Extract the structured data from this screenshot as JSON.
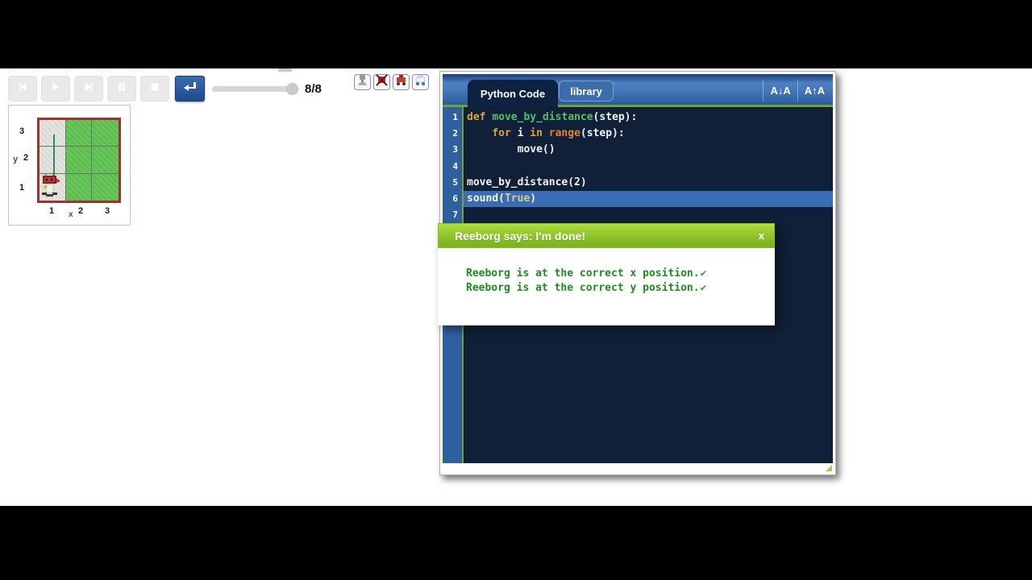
{
  "player": {
    "buttons": [
      {
        "name": "skip-to-start",
        "icon": "skip-to-start"
      },
      {
        "name": "play",
        "icon": "play"
      },
      {
        "name": "skip-to-end",
        "icon": "skip-to-end"
      },
      {
        "name": "pause",
        "icon": "pause"
      },
      {
        "name": "stop",
        "icon": "stop"
      }
    ],
    "run_button_icon": "return-arrow",
    "step_counter": "8/8",
    "slider_position": "end"
  },
  "robot_toolbar": {
    "buttons": [
      {
        "name": "robot-classic",
        "icon": "robot-classic"
      },
      {
        "name": "robot-delete",
        "icon": "robot-delete"
      },
      {
        "name": "robot-rover-red",
        "icon": "robot-rover-red"
      },
      {
        "name": "robot-rover-white",
        "icon": "robot-rover-white"
      }
    ]
  },
  "world": {
    "y_axis_label": "y",
    "x_axis_label": "x",
    "y_ticks": [
      "3",
      "2",
      "1"
    ],
    "x_ticks": [
      "1",
      "2",
      "3"
    ],
    "cells": [
      [
        "path",
        "grass",
        "grass"
      ],
      [
        "path",
        "grass",
        "grass"
      ],
      [
        "path",
        "grass",
        "grass"
      ]
    ],
    "robot_position": "column 1, row 1",
    "trace_color": "#2e8878"
  },
  "editor": {
    "tabs": [
      {
        "label": "Python Code",
        "active": true
      },
      {
        "label": "library",
        "active": false
      }
    ],
    "font_decrease_label": "A↓A",
    "font_increase_label": "A↑A",
    "lines": [
      {
        "num": "1",
        "tokens": [
          {
            "t": "def ",
            "c": "kw"
          },
          {
            "t": "move_by_distance",
            "c": "fn"
          },
          {
            "t": "(step):",
            "c": "pl"
          }
        ]
      },
      {
        "num": "2",
        "tokens": [
          {
            "t": "    ",
            "c": "pl"
          },
          {
            "t": "for",
            "c": "kw"
          },
          {
            "t": " i ",
            "c": "pl"
          },
          {
            "t": "in",
            "c": "kw"
          },
          {
            "t": " ",
            "c": "pl"
          },
          {
            "t": "range",
            "c": "bi"
          },
          {
            "t": "(step):",
            "c": "pl"
          }
        ]
      },
      {
        "num": "3",
        "tokens": [
          {
            "t": "        move()",
            "c": "pl"
          }
        ]
      },
      {
        "num": "4",
        "tokens": []
      },
      {
        "num": "5",
        "tokens": [
          {
            "t": "move_by_distance(2)",
            "c": "pl"
          }
        ]
      },
      {
        "num": "6",
        "highlight": true,
        "tokens": [
          {
            "t": "sound(",
            "c": "pl"
          },
          {
            "t": "True",
            "c": "const"
          },
          {
            "t": ")",
            "c": "pl"
          }
        ]
      },
      {
        "num": "7",
        "tokens": []
      }
    ]
  },
  "dialog": {
    "title": "Reeborg says: I'm done!",
    "close_label": "x",
    "lines": [
      {
        "text": "Reeborg is at the correct x position.",
        "check": "✔"
      },
      {
        "text": "Reeborg is at the correct y position.",
        "check": "✔"
      }
    ]
  },
  "colors": {
    "accent_green": "#76a12f",
    "header_blue": "#3f71b2",
    "active_tab_navy": "#0d2140",
    "code_background": "#0f2038",
    "gutter_blue": "#2e5f9e",
    "highlight_row": "#3a6cb5",
    "dialog_green": "#8cc22a",
    "result_text_green": "#1f8c1f",
    "world_border_red": "#993430",
    "grass_green": "#5cbe4e"
  }
}
